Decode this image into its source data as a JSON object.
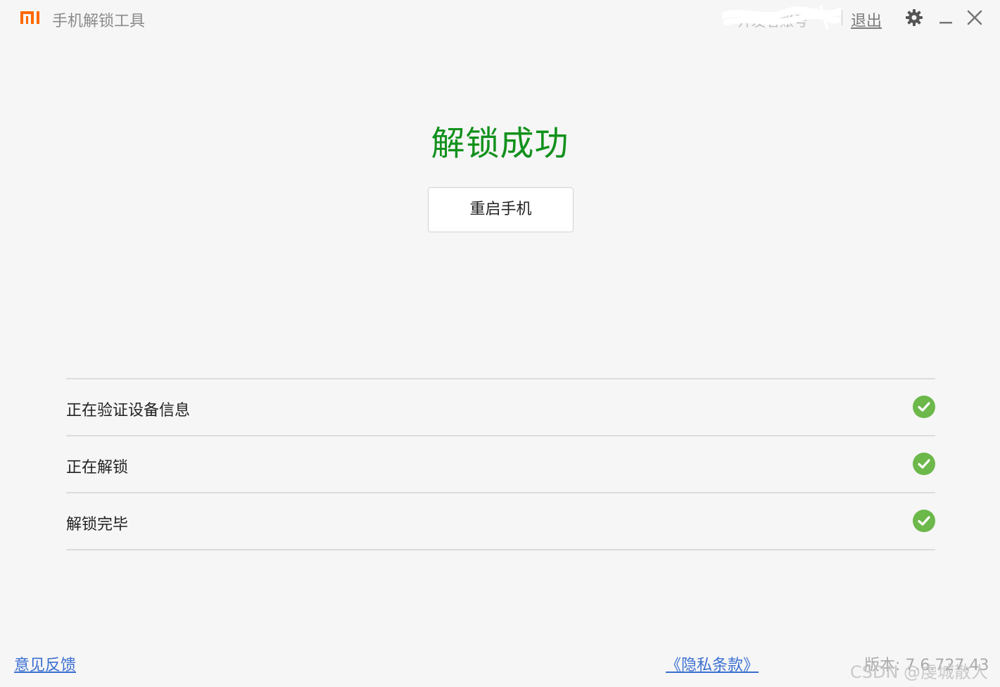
{
  "app": {
    "title": "手机解锁工具",
    "logo_text": "mi",
    "brand_color": "#ff6700"
  },
  "header": {
    "account_name": "开发者账号",
    "logout_label": "退出",
    "icons": [
      "gear-icon",
      "minimize-icon",
      "close-icon"
    ]
  },
  "main": {
    "result_title": "解锁成功",
    "result_color": "#12911c",
    "restart_label": "重启手机"
  },
  "steps": [
    {
      "label": "正在验证设备信息",
      "status": "done"
    },
    {
      "label": "正在解锁",
      "status": "done"
    },
    {
      "label": "解锁完毕",
      "status": "done"
    }
  ],
  "status_color": "#6cb84a",
  "footer": {
    "feedback_label": "意见反馈",
    "privacy_label": "《隐私条款》",
    "version_text": "版本: 7.6.727.43",
    "watermark": "CSDN @虔城散人"
  }
}
